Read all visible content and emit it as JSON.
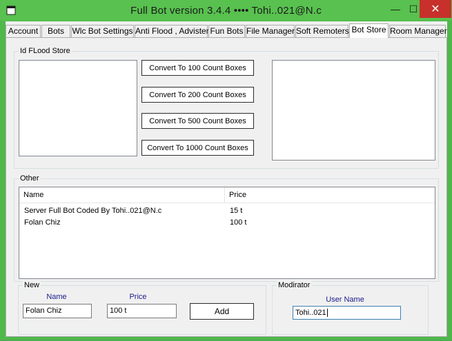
{
  "window": {
    "title": "Full Bot   version  3.4.4    ••••    Tohi..021@N.c",
    "minimize_glyph": "—",
    "maximize_glyph": "☐",
    "close_glyph": "✕"
  },
  "tabs": [
    {
      "label": "Account"
    },
    {
      "label": "Bots"
    },
    {
      "label": "Wlc Bot Settings"
    },
    {
      "label": "Anti Flood , Advister"
    },
    {
      "label": "Fun Bots"
    },
    {
      "label": "File Manager"
    },
    {
      "label": "Soft Remoters"
    },
    {
      "label": "Bot Store",
      "active": true
    },
    {
      "label": "Room Manager"
    }
  ],
  "id_flood_store": {
    "title": "Id FLood Store",
    "buttons": [
      "Convert To 100 Count Boxes",
      "Convert To 200 Count Boxes",
      "Convert To 500 Count Boxes",
      "Convert To 1000 Count Boxes"
    ]
  },
  "other": {
    "title": "Other",
    "columns": [
      "Name",
      "Price"
    ],
    "rows": [
      {
        "name": "Server Full Bot Coded By Tohi..021@N.c",
        "price": "15 t"
      },
      {
        "name": "Folan Chiz",
        "price": "100 t"
      }
    ]
  },
  "new": {
    "title": "New",
    "name_label": "Name",
    "price_label": "Price",
    "name_value": "Folan Chiz",
    "price_value": "100 t",
    "add_label": "Add"
  },
  "moderator": {
    "title": "Modirator",
    "user_name_label": "User Name",
    "user_name_value": "Tohi..021"
  },
  "colors": {
    "title_bar": "#58c14f",
    "close_button": "#c7302b",
    "label_text": "#1a1a8c"
  }
}
